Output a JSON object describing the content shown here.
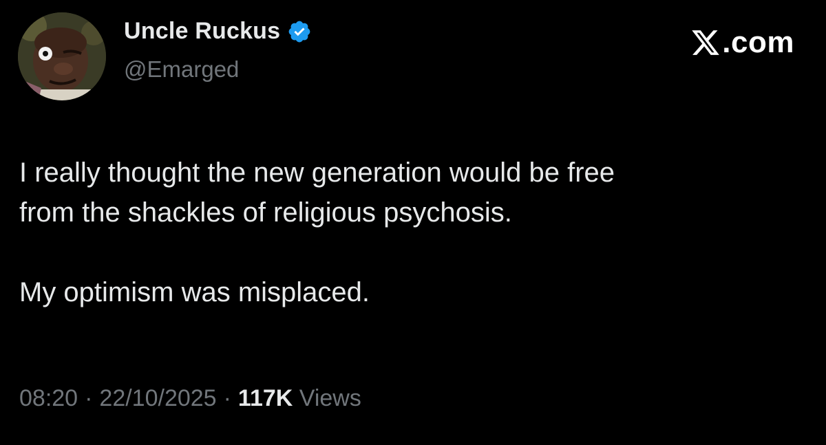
{
  "author": {
    "display_name": "Uncle Ruckus",
    "handle": "@Emarged",
    "verified_icon": "verified-badge-icon",
    "verified_color": "#1d9bf0"
  },
  "brand": {
    "logo_icon": "x-logo-icon",
    "suffix": ".com"
  },
  "tweet": {
    "line1": "I really thought the new generation would be free",
    "line2": "from the shackles of religious psychosis.",
    "line3": "My optimism was misplaced."
  },
  "meta": {
    "time": "08:20",
    "separator": "·",
    "date": "22/10/2025",
    "views_count": "117K",
    "views_label": "Views"
  },
  "colors": {
    "background": "#000000",
    "text": "#e7e9ea",
    "secondary": "#71767b"
  }
}
